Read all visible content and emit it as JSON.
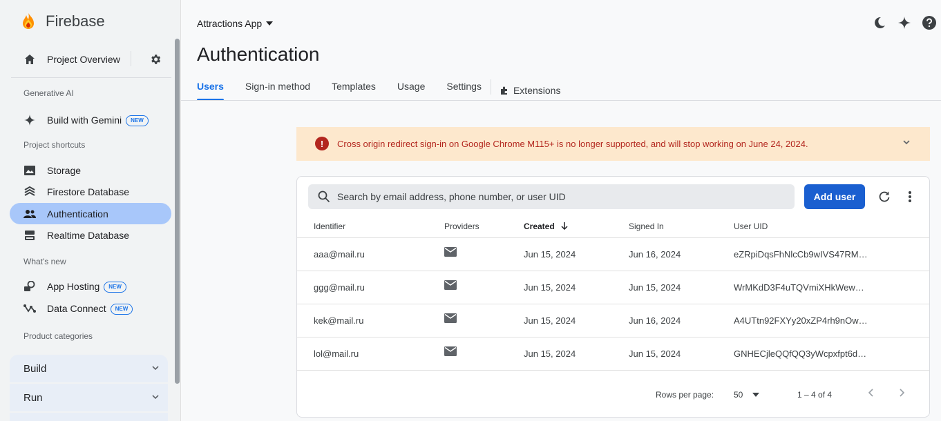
{
  "sidebar": {
    "brand": "Firebase",
    "project_overview": "Project Overview",
    "sections": {
      "generative_ai": "Generative AI",
      "project_shortcuts": "Project shortcuts",
      "whats_new": "What's new",
      "product_categories": "Product categories"
    },
    "build_with_gemini": "Build with Gemini",
    "new_badge": "NEW",
    "shortcuts": [
      "Storage",
      "Firestore Database",
      "Authentication",
      "Realtime Database"
    ],
    "whats_new_items": [
      "App Hosting",
      "Data Connect"
    ],
    "categories": [
      "Build",
      "Run"
    ]
  },
  "header": {
    "project": "Attractions App",
    "title": "Authentication"
  },
  "tabs": [
    "Users",
    "Sign-in method",
    "Templates",
    "Usage",
    "Settings",
    "Extensions"
  ],
  "active_tab": "Users",
  "banner": {
    "message": "Cross origin redirect sign-in on Google Chrome M115+ is no longer supported, and will stop working on June 24, 2024."
  },
  "users_table": {
    "search_placeholder": "Search by email address, phone number, or user UID",
    "add_user_label": "Add user",
    "columns": [
      "Identifier",
      "Providers",
      "Created",
      "Signed In",
      "User UID"
    ],
    "rows": [
      {
        "identifier": "aaa@mail.ru",
        "provider": "email",
        "created": "Jun 15, 2024",
        "signed_in": "Jun 16, 2024",
        "uid": "eZRpiDqsFhNlcCb9wIVS47RM…"
      },
      {
        "identifier": "ggg@mail.ru",
        "provider": "email",
        "created": "Jun 15, 2024",
        "signed_in": "Jun 15, 2024",
        "uid": "WrMKdD3F4uTQVmiXHkWew…"
      },
      {
        "identifier": "kek@mail.ru",
        "provider": "email",
        "created": "Jun 15, 2024",
        "signed_in": "Jun 16, 2024",
        "uid": "A4UTtn92FXYy20xZP4rh9nOw…"
      },
      {
        "identifier": "lol@mail.ru",
        "provider": "email",
        "created": "Jun 15, 2024",
        "signed_in": "Jun 15, 2024",
        "uid": "GNHECjleQQfQQ3yWcpxfpt6d…"
      }
    ],
    "footer": {
      "rows_per_page_label": "Rows per page:",
      "rows_per_page_value": "50",
      "range": "1 – 4 of 4"
    }
  },
  "colors": {
    "accent": "#1a73e8",
    "banner_bg": "#fde8cd",
    "banner_text": "#b3261e",
    "active_nav": "#a8c7fa"
  }
}
